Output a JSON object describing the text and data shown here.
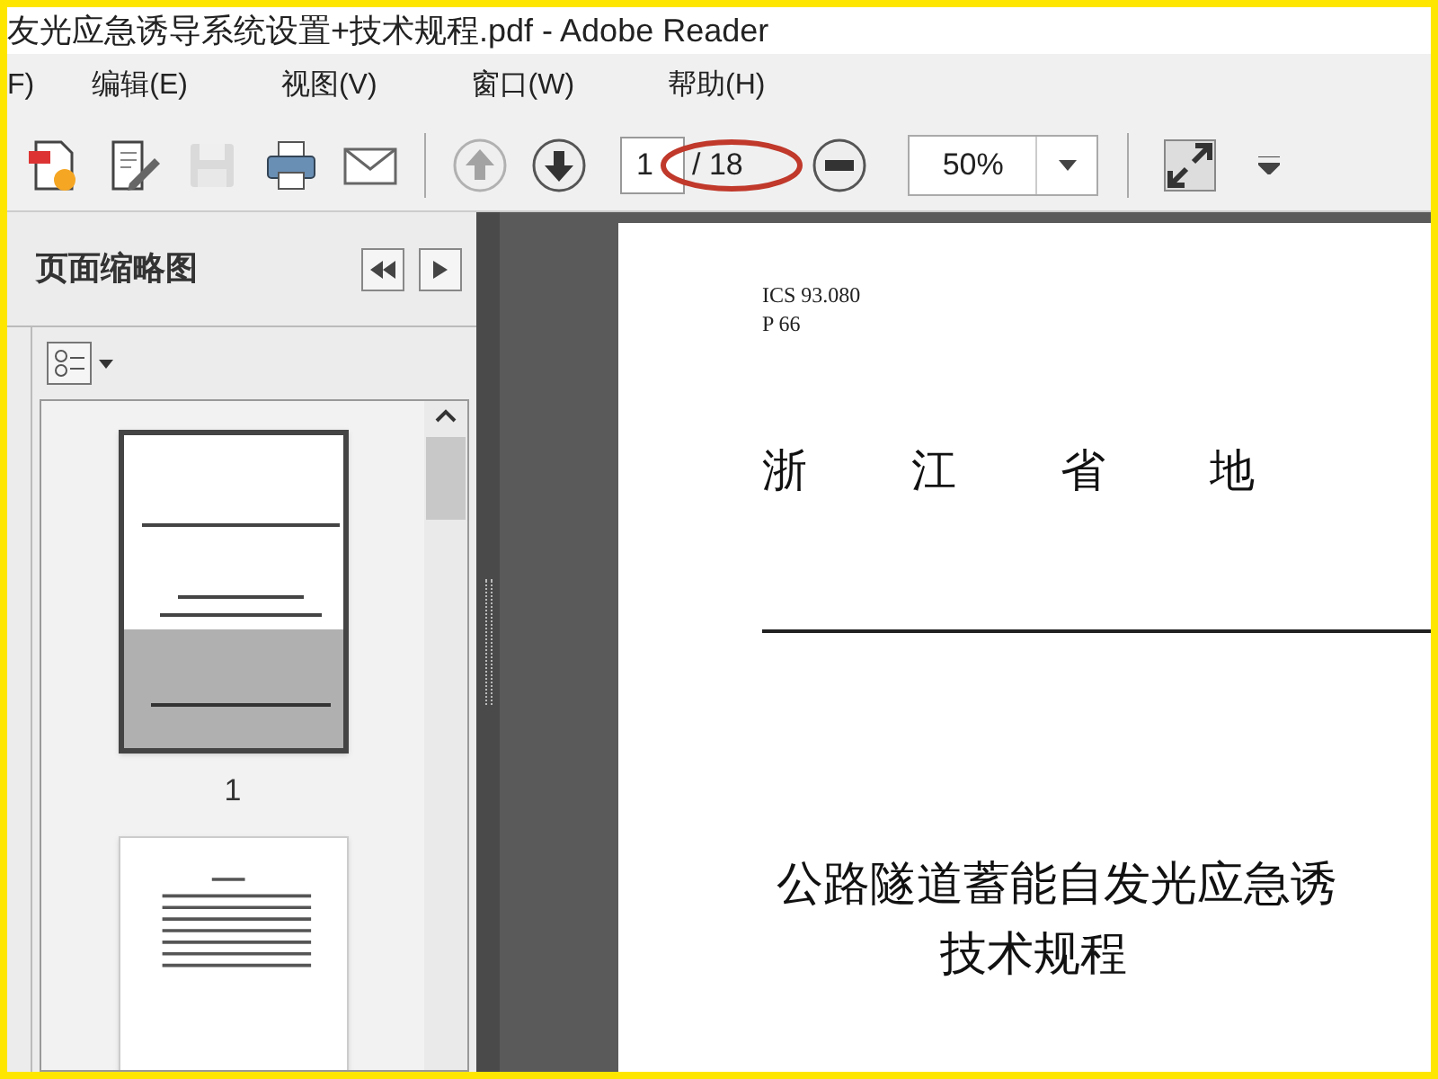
{
  "window": {
    "title": "友光应急诱导系统设置+技术规程.pdf - Adobe Reader"
  },
  "menu": [
    {
      "label": "F)"
    },
    {
      "label": "编辑(E)"
    },
    {
      "label": "视图(V)"
    },
    {
      "label": "窗口(W)"
    },
    {
      "label": "帮助(H)"
    }
  ],
  "toolbar": {
    "tools": [
      {
        "disabled": false
      },
      {
        "disabled": false
      },
      {
        "disabled": true
      },
      {
        "disabled": false
      },
      {
        "disabled": false
      }
    ],
    "nav": [
      {
        "disabled": true
      },
      {
        "disabled": false
      }
    ],
    "page_field": {
      "value": "1"
    },
    "page_total": "/ 18",
    "zoom_field": {
      "value": "50%"
    }
  },
  "thumbnails_panel": {
    "title": "页面缩略图",
    "thumbnails": [
      {
        "label": "1",
        "selected": true
      },
      {
        "selected": false
      }
    ]
  },
  "document": {
    "header_lines": [
      "ICS 93.080",
      "P 66"
    ],
    "heading_chars": [
      "浙",
      "江",
      "省",
      "地"
    ],
    "title_lines": [
      "公路隧道蓄能自发光应急诱",
      "技术规程"
    ]
  }
}
